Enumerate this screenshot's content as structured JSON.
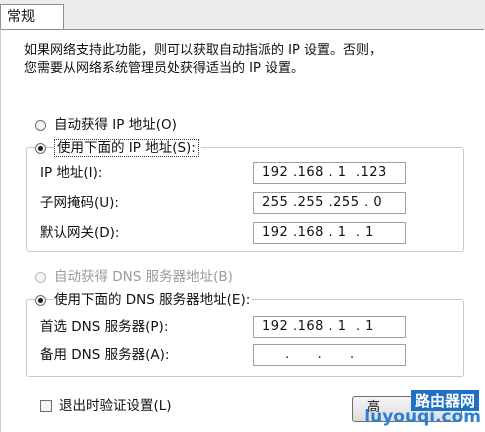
{
  "tab": {
    "label": "常规"
  },
  "description": {
    "line1": "如果网络支持此功能，则可以获取自动指派的 IP 设置。否则，",
    "line2": "您需要从网络系统管理员处获得适当的 IP 设置。"
  },
  "ip": {
    "auto_label": "自动获得 IP 地址(O)",
    "manual_label": "使用下面的 IP 地址(S):",
    "selected": "manual",
    "fields": [
      {
        "label": "IP 地址(I):",
        "value": "192 .168 . 1  .123"
      },
      {
        "label": "子网掩码(U):",
        "value": "255 .255 .255 . 0"
      },
      {
        "label": "默认网关(D):",
        "value": "192 .168 . 1  . 1"
      }
    ]
  },
  "dns": {
    "auto_label": "自动获得 DNS 服务器地址(B)",
    "manual_label": "使用下面的 DNS 服务器地址(E):",
    "selected": "manual",
    "fields": [
      {
        "label": "首选 DNS 服务器(P):",
        "value": "192 .168 . 1  . 1"
      },
      {
        "label": "备用 DNS 服务器(A):",
        "value": "     .      .      ."
      }
    ]
  },
  "validate_on_exit": {
    "label": "退出时验证设置(L)",
    "checked": false
  },
  "advanced_button": {
    "label": "高"
  },
  "watermark": {
    "line1": "路由器网",
    "line2": "luyouqi.com"
  }
}
